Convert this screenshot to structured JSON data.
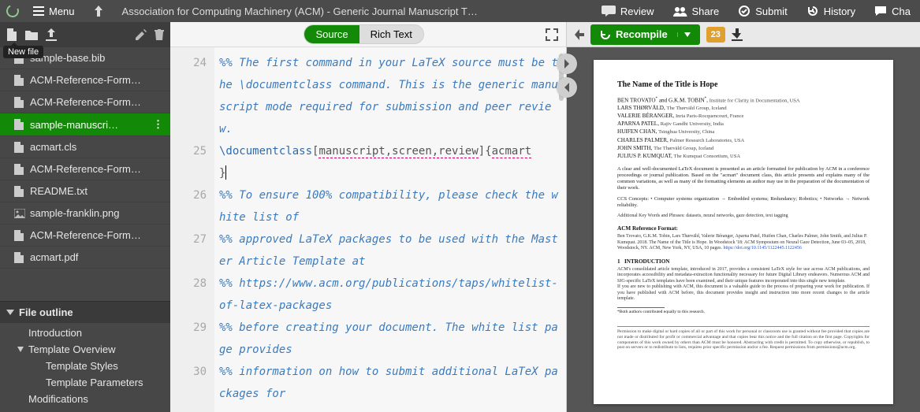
{
  "topbar": {
    "menu": "Menu",
    "title": "Association for Computing Machinery (ACM) - Generic Journal Manuscript T…",
    "review": "Review",
    "share": "Share",
    "submit": "Submit",
    "history": "History",
    "chat": "Cha"
  },
  "sidebar": {
    "tooltip": "New file",
    "files": [
      {
        "icon": "file",
        "label": "sample-base.bib",
        "indent": 0
      },
      {
        "icon": "file",
        "label": "ACM-Reference-Form…",
        "indent": 0
      },
      {
        "icon": "file",
        "label": "ACM-Reference-Form…",
        "indent": 0
      },
      {
        "icon": "file",
        "label": "sample-manuscri…",
        "indent": 0,
        "active": true
      },
      {
        "icon": "file",
        "label": "acmart.cls",
        "indent": 0
      },
      {
        "icon": "file",
        "label": "ACM-Reference-Form…",
        "indent": 0
      },
      {
        "icon": "file",
        "label": "README.txt",
        "indent": 0
      },
      {
        "icon": "image",
        "label": "sample-franklin.png",
        "indent": 0
      },
      {
        "icon": "file",
        "label": "ACM-Reference-Form…",
        "indent": 0
      },
      {
        "icon": "file",
        "label": "acmart.pdf",
        "indent": 0
      }
    ],
    "outline_header": "File outline",
    "outline": [
      {
        "label": "Introduction",
        "lvl": 1,
        "caret": false
      },
      {
        "label": "Template Overview",
        "lvl": 1,
        "caret": true
      },
      {
        "label": "Template Styles",
        "lvl": 2,
        "caret": false
      },
      {
        "label": "Template Parameters",
        "lvl": 2,
        "caret": false
      },
      {
        "label": "Modifications",
        "lvl": 1,
        "caret": false
      }
    ]
  },
  "editor": {
    "source_label": "Source",
    "rich_label": "Rich Text",
    "lines": [
      {
        "n": 24,
        "type": "comment",
        "text": "%% The first command in your LaTeX source must be the \\documentclass command. This is the generic manuscript mode required for submission and peer review.",
        "wrap": 4
      },
      {
        "n": 25,
        "type": "cmd",
        "raw": true,
        "wrap": 2
      },
      {
        "n": 26,
        "type": "comment",
        "text": "%% To ensure 100% compatibility, please check the white list of",
        "wrap": 2
      },
      {
        "n": 27,
        "type": "comment",
        "text": "%% approved LaTeX packages to be used with the Master Article Template at",
        "wrap": 2
      },
      {
        "n": 28,
        "type": "comment",
        "text": "%% https://www.acm.org/publications/taps/whitelist-of-latex-packages",
        "wrap": 2
      },
      {
        "n": 29,
        "type": "comment",
        "text": "%% before creating your document. The white list page provides",
        "wrap": 2
      },
      {
        "n": 30,
        "type": "comment",
        "text": "%% information on how to submit additional LaTeX packages for",
        "wrap": 2
      }
    ],
    "cmd_parts": {
      "cmd": "\\documentclass",
      "opts": "manuscript,screen,review",
      "cls": "acmart"
    }
  },
  "pdf": {
    "recompile": "Recompile",
    "warn_count": "23"
  },
  "paper": {
    "title": "The Name of the Title is Hope",
    "authors": [
      {
        "name": "BEN TROVATO",
        "sup": "*",
        "extra": " and G.K.M. TOBIN",
        "sup2": "*",
        "aff": "Institute for Clarity in Documentation, USA"
      },
      {
        "name": "LARS THØRVÄLD",
        "aff": "The Thørväld Group, Iceland"
      },
      {
        "name": "VALERIE BÉRANGER",
        "aff": "Inria Paris-Rocquencourt, France"
      },
      {
        "name": "APARNA PATEL",
        "aff": "Rajiv Gandhi University, India"
      },
      {
        "name": "HUIFEN CHAN",
        "aff": "Tsinghua University, China"
      },
      {
        "name": "CHARLES PALMER",
        "aff": "Palmer Research Laboratories, USA"
      },
      {
        "name": "JOHN SMITH",
        "aff": "The Thørväld Group, Iceland"
      },
      {
        "name": "JULIUS P. KUMQUAT",
        "aff": "The Kumquat Consortium, USA"
      }
    ],
    "abstract": "A clear and well-documented LaTeX document is presented as an article formatted for publication by ACM in a conference proceedings or journal publication. Based on the \"acmart\" document class, this article presents and explains many of the common variations, as well as many of the formatting elements an author may use in the preparation of the documentation of their work.",
    "ccs": "CCS Concepts: • Computer systems organization → Embedded systems; Redundancy; Robotics; • Networks → Network reliability.",
    "keywords": "Additional Key Words and Phrases: datasets, neural networks, gaze detection, text tagging",
    "refformat_h": "ACM Reference Format:",
    "refformat": "Ben Trovato, G.K.M. Tobin, Lars Thørväld, Valerie Béranger, Aparna Patel, Huifen Chan, Charles Palmer, John Smith, and Julius P. Kumquat. 2018. The Name of the Title is Hope. In Woodstock '18: ACM Symposium on Neural Gaze Detection, June 03–05, 2018, Woodstock, NY. ACM, New York, NY, USA, 10 pages. ",
    "doi": "https://doi.org/10.1145/1122445.1122456",
    "sec1_num": "1",
    "sec1_title": "INTRODUCTION",
    "intro": "ACM's consolidated article template, introduced in 2017, provides a consistent LaTeX style for use across ACM publications, and incorporates accessibility and metadata-extraction functionality necessary for future Digital Library endeavors. Numerous ACM and SIG-specific LaTeX templates have been examined, and their unique features incorporated into this single new template.\n   If you are new to publishing with ACM, this document is a valuable guide to the process of preparing your work for publication. If you have published with ACM before, this document provides insight and instruction into more recent changes to the article template.",
    "star_note": "*Both authors contributed equally to this research.",
    "footer": "Permission to make digital or hard copies of all or part of this work for personal or classroom use is granted without fee provided that copies are not made or distributed for profit or commercial advantage and that copies bear this notice and the full citation on the first page. Copyrights for components of this work owned by others than ACM must be honored. Abstracting with credit is permitted. To copy otherwise, or republish, to post on servers or to redistribute to lists, requires prior specific permission and/or a fee. Request permissions from permissions@acm.org."
  }
}
